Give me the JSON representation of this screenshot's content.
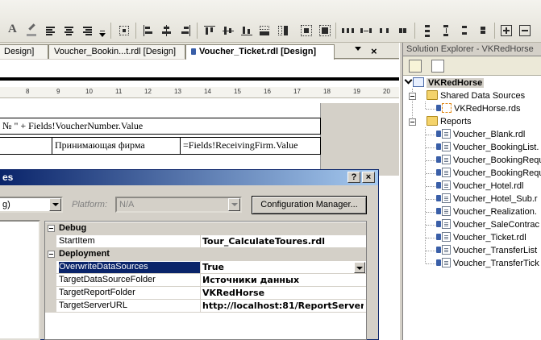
{
  "doc_tabs": {
    "tab1": "Design]",
    "tab2": "Voucher_Bookin...t.rdl [Design]",
    "tab3": "Voucher_Ticket.rdl [Design]",
    "close_glyph": "×"
  },
  "ruler": {
    "numbers": [
      "8",
      "9",
      "10",
      "11",
      "12",
      "13",
      "14",
      "15",
      "16",
      "17",
      "18",
      "19",
      "20"
    ]
  },
  "report": {
    "row1_expr": "№ \" + Fields!VoucherNumber.Value",
    "row2_label": "Принимающая фирма",
    "row2_expr": "=Fields!ReceivingFirm.Value"
  },
  "dialog": {
    "title": "es",
    "help_glyph": "?",
    "close_glyph": "×",
    "configuration_value": "g)",
    "platform_label": "Platform:",
    "platform_value": "N/A",
    "config_manager_button": "Configuration Manager..."
  },
  "property_grid": {
    "debug_category": "Debug",
    "start_item_name": "StartItem",
    "start_item_value": "Tour_CalculateToures.rdl",
    "deployment_category": "Deployment",
    "overwrite_name": "OverwriteDataSources",
    "overwrite_value": "True",
    "target_ds_folder_name": "TargetDataSourceFolder",
    "target_ds_folder_value": "Источники данных",
    "target_report_folder_name": "TargetReportFolder",
    "target_report_folder_value": "VKRedHorse",
    "target_server_url_name": "TargetServerURL",
    "target_server_url_value": "http://localhost:81/ReportServer"
  },
  "solution_explorer": {
    "title": "Solution Explorer - VKRedHorse",
    "project": "VKRedHorse",
    "shared_data_sources": "Shared Data Sources",
    "data_source_file": "VKRedHorse.rds",
    "reports_folder": "Reports",
    "reports": [
      "Voucher_Blank.rdl",
      "Voucher_BookingList.",
      "Voucher_BookingRequ",
      "Voucher_BookingRequ",
      "Voucher_Hotel.rdl",
      "Voucher_Hotel_Sub.r",
      "Voucher_Realization.",
      "Voucher_SaleContrac",
      "Voucher_Ticket.rdl",
      "Voucher_TransferList",
      "Voucher_TransferTick"
    ]
  },
  "colors": {
    "titlebar_start": "#0a246a",
    "titlebar_end": "#a6caf0",
    "selection": "#0a246a",
    "chrome": "#d4d0c8"
  }
}
